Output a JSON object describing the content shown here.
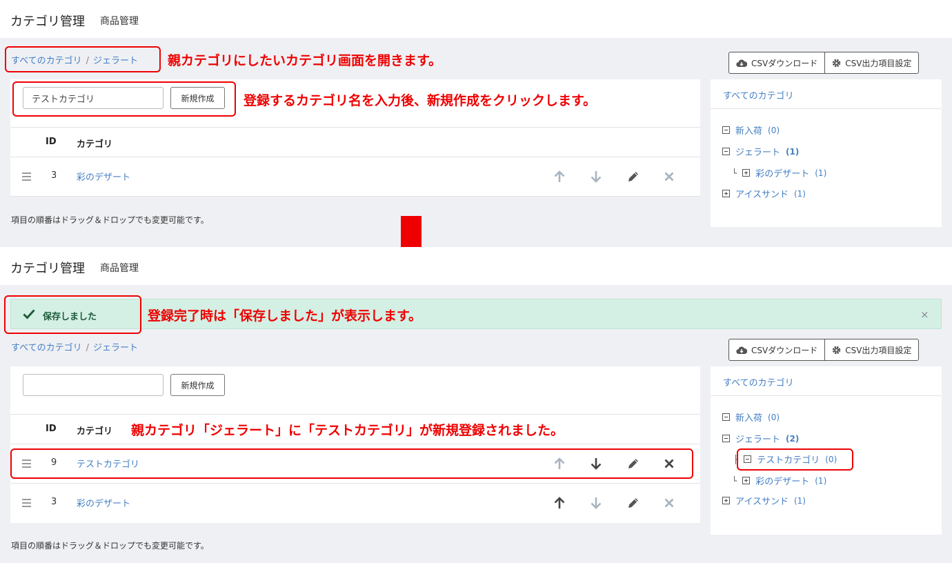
{
  "top": {
    "header": {
      "title": "カテゴリ管理",
      "subtitle": "商品管理"
    },
    "breadcrumb": {
      "all": "すべてのカテゴリ",
      "sep": "/",
      "current": "ジェラート"
    },
    "csv": {
      "download": "CSVダウンロード",
      "settings": "CSV出力項目設定"
    },
    "form": {
      "input_value": "テストカテゴリ",
      "create": "新規作成"
    },
    "table": {
      "headers": {
        "id": "ID",
        "category": "カテゴリ"
      },
      "rows": [
        {
          "id": "3",
          "name": "彩のデザート"
        }
      ]
    },
    "footer": "項目の順番はドラッグ＆ドロップでも変更可能です。",
    "sidebar": {
      "title": "すべてのカテゴリ",
      "items": [
        {
          "label": "新入荷",
          "count": "(0)"
        },
        {
          "label": "ジェラート",
          "count": "(1)"
        },
        {
          "label": "彩のデザート",
          "count": "(1)"
        },
        {
          "label": "アイスサンド",
          "count": "(1)"
        }
      ]
    },
    "notes": {
      "n1": "親カテゴリにしたいカテゴリ画面を開きます。",
      "n2": "登録するカテゴリ名を入力後、新規作成をクリックします。"
    }
  },
  "bottom": {
    "header": {
      "title": "カテゴリ管理",
      "subtitle": "商品管理"
    },
    "alert": {
      "message": "保存しました",
      "close": "×"
    },
    "breadcrumb": {
      "all": "すべてのカテゴリ",
      "sep": "/",
      "current": "ジェラート"
    },
    "csv": {
      "download": "CSVダウンロード",
      "settings": "CSV出力項目設定"
    },
    "form": {
      "input_value": "",
      "create": "新規作成"
    },
    "table": {
      "headers": {
        "id": "ID",
        "category": "カテゴリ"
      },
      "rows": [
        {
          "id": "9",
          "name": "テストカテゴリ"
        },
        {
          "id": "3",
          "name": "彩のデザート"
        }
      ]
    },
    "footer": "項目の順番はドラッグ＆ドロップでも変更可能です。",
    "sidebar": {
      "title": "すべてのカテゴリ",
      "items": [
        {
          "label": "新入荷",
          "count": "(0)"
        },
        {
          "label": "ジェラート",
          "count": "(2)"
        },
        {
          "label": "テストカテゴリ",
          "count": "(0)"
        },
        {
          "label": "彩のデザート",
          "count": "(1)"
        },
        {
          "label": "アイスサンド",
          "count": "(1)"
        }
      ]
    },
    "notes": {
      "n3": "登録完了時は「保存しました」が表示します。",
      "n4": "親カテゴリ「ジェラート」に「テストカテゴリ」が新規登録されました。"
    }
  },
  "colors": {
    "accent": "#437ec4",
    "annotation": "#ee0000",
    "alert_bg": "#d4efe4",
    "alert_text": "#1e5c3a"
  },
  "icons": [
    "cloud-download-icon",
    "gear-icon",
    "drag-handle-icon",
    "arrow-up-icon",
    "arrow-down-icon",
    "pencil-icon",
    "close-icon",
    "check-icon",
    "down-arrow-icon"
  ]
}
